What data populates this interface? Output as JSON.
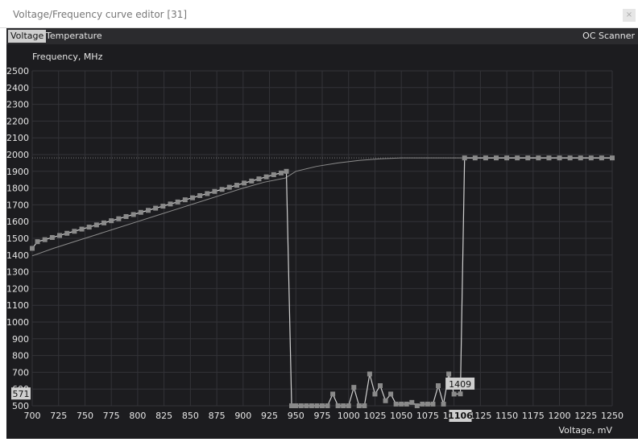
{
  "window": {
    "title": "Voltage/Frequency curve editor [31]",
    "close_label": "×"
  },
  "tabs": [
    {
      "label": "Voltage",
      "active": true
    },
    {
      "label": "Temperature",
      "active": false
    }
  ],
  "oc_scanner_label": "OC Scanner",
  "colors": {
    "plot_background": "#1c1c1f",
    "grid": "#333338",
    "curve": "#d0d0d0",
    "points": "#8a8a8a",
    "text": "#e6e6e6",
    "highlight": "#cfcfcf"
  },
  "chart_data": {
    "type": "line",
    "title": "",
    "ylabel": "Frequency, MHz",
    "xlabel": "Voltage, mV",
    "xlim": [
      700,
      1250
    ],
    "ylim": [
      500,
      2500
    ],
    "x_ticks": [
      700,
      725,
      750,
      775,
      800,
      825,
      850,
      875,
      900,
      925,
      950,
      975,
      1000,
      1025,
      1050,
      1075,
      1100,
      1125,
      1150,
      1175,
      1200,
      1225,
      1250
    ],
    "y_ticks": [
      500,
      600,
      700,
      800,
      900,
      1000,
      1100,
      1200,
      1300,
      1400,
      1500,
      1600,
      1700,
      1800,
      1900,
      2000,
      2100,
      2200,
      2300,
      2400,
      2500
    ],
    "max_line_mhz": 1980,
    "cursor": {
      "voltage_label": "1106",
      "frequency_label": "571",
      "point_label": "1409"
    },
    "series": [
      {
        "role": "edited curve",
        "points": [
          [
            700,
            1440
          ],
          [
            705,
            1480
          ],
          [
            712,
            1492
          ],
          [
            719,
            1505
          ],
          [
            726,
            1517
          ],
          [
            733,
            1530
          ],
          [
            740,
            1542
          ],
          [
            747,
            1555
          ],
          [
            754,
            1567
          ],
          [
            761,
            1580
          ],
          [
            768,
            1592
          ],
          [
            775,
            1605
          ],
          [
            782,
            1617
          ],
          [
            789,
            1630
          ],
          [
            796,
            1642
          ],
          [
            803,
            1655
          ],
          [
            810,
            1667
          ],
          [
            817,
            1680
          ],
          [
            824,
            1692
          ],
          [
            831,
            1705
          ],
          [
            838,
            1717
          ],
          [
            845,
            1730
          ],
          [
            852,
            1742
          ],
          [
            859,
            1755
          ],
          [
            866,
            1767
          ],
          [
            873,
            1780
          ],
          [
            880,
            1792
          ],
          [
            887,
            1805
          ],
          [
            894,
            1817
          ],
          [
            901,
            1830
          ],
          [
            908,
            1842
          ],
          [
            915,
            1855
          ],
          [
            922,
            1867
          ],
          [
            929,
            1880
          ],
          [
            936,
            1890
          ],
          [
            941,
            1900
          ],
          [
            946,
            500
          ],
          [
            950,
            500
          ],
          [
            955,
            500
          ],
          [
            960,
            500
          ],
          [
            965,
            500
          ],
          [
            970,
            500
          ],
          [
            975,
            500
          ],
          [
            980,
            500
          ],
          [
            985,
            570
          ],
          [
            990,
            500
          ],
          [
            995,
            500
          ],
          [
            1000,
            500
          ],
          [
            1005,
            610
          ],
          [
            1010,
            500
          ],
          [
            1015,
            500
          ],
          [
            1020,
            690
          ],
          [
            1025,
            570
          ],
          [
            1030,
            620
          ],
          [
            1035,
            530
          ],
          [
            1040,
            570
          ],
          [
            1045,
            510
          ],
          [
            1050,
            510
          ],
          [
            1055,
            510
          ],
          [
            1060,
            520
          ],
          [
            1065,
            500
          ],
          [
            1070,
            510
          ],
          [
            1075,
            510
          ],
          [
            1080,
            510
          ],
          [
            1085,
            620
          ],
          [
            1090,
            510
          ],
          [
            1095,
            690
          ],
          [
            1100,
            570
          ],
          [
            1106,
            571
          ],
          [
            1110,
            1980
          ],
          [
            1120,
            1980
          ],
          [
            1130,
            1980
          ],
          [
            1140,
            1980
          ],
          [
            1150,
            1980
          ],
          [
            1160,
            1980
          ],
          [
            1170,
            1980
          ],
          [
            1180,
            1980
          ],
          [
            1190,
            1980
          ],
          [
            1200,
            1980
          ],
          [
            1210,
            1980
          ],
          [
            1220,
            1980
          ],
          [
            1230,
            1980
          ],
          [
            1240,
            1980
          ],
          [
            1250,
            1980
          ]
        ]
      },
      {
        "role": "default curve",
        "points": [
          [
            700,
            1395
          ],
          [
            720,
            1440
          ],
          [
            740,
            1480
          ],
          [
            760,
            1520
          ],
          [
            780,
            1560
          ],
          [
            800,
            1600
          ],
          [
            820,
            1640
          ],
          [
            840,
            1680
          ],
          [
            860,
            1720
          ],
          [
            880,
            1760
          ],
          [
            900,
            1800
          ],
          [
            920,
            1835
          ],
          [
            940,
            1860
          ],
          [
            950,
            1900
          ],
          [
            970,
            1930
          ],
          [
            990,
            1950
          ],
          [
            1010,
            1965
          ],
          [
            1030,
            1975
          ],
          [
            1050,
            1980
          ],
          [
            1100,
            1980
          ],
          [
            1250,
            1980
          ]
        ]
      }
    ]
  }
}
